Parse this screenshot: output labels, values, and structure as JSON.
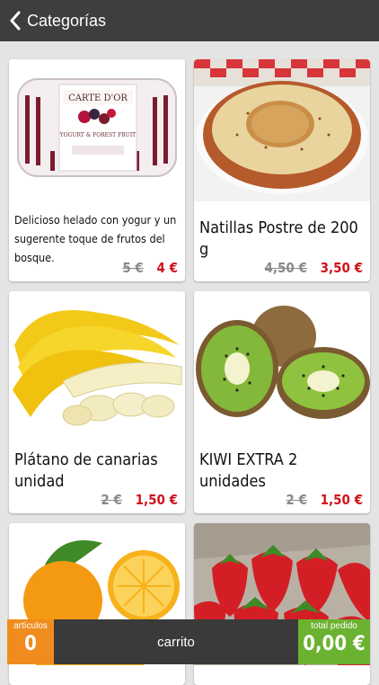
{
  "header": {
    "title": "Categorías",
    "back_icon": "chevron-left-icon"
  },
  "products": [
    {
      "name": "Delicioso helado con yogur y un sugerente toque de frutos del bosque.",
      "old_price": "5 €",
      "new_price": "4 €",
      "image": "ice-cream-tub"
    },
    {
      "name": "Natillas  Postre de 200 g",
      "old_price": "4,50 €",
      "new_price": "3,50 €",
      "image": "custard-bowl"
    },
    {
      "name": "Plátano de canarias  unidad",
      "old_price": "2 €",
      "new_price": "1,50 €",
      "image": "bananas"
    },
    {
      "name": "KIWI EXTRA 2 unidades",
      "old_price": "2 €",
      "new_price": "1,50 €",
      "image": "kiwis"
    },
    {
      "name": "",
      "image": "oranges"
    },
    {
      "name": "",
      "image": "strawberries"
    }
  ],
  "cart": {
    "articles_label": "artículos",
    "articles_count": "0",
    "cart_label": "carrito",
    "total_label": "total pedido",
    "total_value": "0,00 €"
  },
  "colors": {
    "header_bg": "#3e3e3e",
    "price_red": "#d0121b",
    "articles_orange": "#f08c1e",
    "total_green": "#6cb231",
    "bar_bg": "#3a3a3a"
  }
}
